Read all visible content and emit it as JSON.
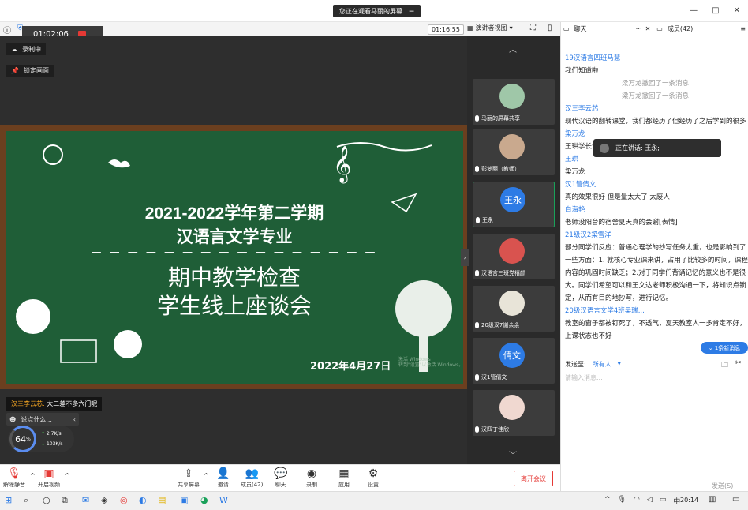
{
  "window": {
    "share_status": "您正在观看马丽的屏幕",
    "share_menu_icon": "menu-icon",
    "minimize": "—",
    "restore": "□",
    "close": "✕"
  },
  "toolbar": {
    "meeting_time": "01:16:55",
    "view_label": "演讲者视图",
    "recording_time": "01:02:06"
  },
  "stage": {
    "recording_label": "录制中",
    "lock_label": "锁定画面",
    "board": {
      "line1": "2021-2022学年第二学期",
      "line2": "汉语言文学专业",
      "dashes": "— — — — — — — — — — — — — — — —",
      "line3": "期中教学检查",
      "line4": "学生线上座谈会",
      "date": "2022年4月27日",
      "watermark1": "激活 Windows",
      "watermark2": "转到\"设置\"以激活 Windows。"
    },
    "toast": {
      "sender": "汉三李云芯:",
      "text": "大二差不多六门呢"
    },
    "quick_chat": "说点什么...",
    "network": {
      "percent": "64",
      "unit": "%",
      "up": "2.7K/s",
      "down": "103K/s"
    }
  },
  "participants": [
    {
      "name": "马丽的屏幕共享",
      "avatar_text": "",
      "color": "#9fc7a8"
    },
    {
      "name": "彭梦丽（教师）",
      "avatar_text": "",
      "color": "#c9a98e"
    },
    {
      "name": "王永",
      "avatar_text": "王永",
      "color": "#2d7be5"
    },
    {
      "name": "汉语言三班党禧颜",
      "avatar_text": "",
      "color": "#d9534f"
    },
    {
      "name": "20级汉7谢余余",
      "avatar_text": "",
      "color": "#e8e4d8"
    },
    {
      "name": "汉1管倩文",
      "avatar_text": "倩文",
      "color": "#2d7be5"
    },
    {
      "name": "汉四丁佳欣",
      "avatar_text": "",
      "color": "#f0d8d0"
    }
  ],
  "bottombar": {
    "mute": "解除静音",
    "video": "开启视频",
    "share": "共享屏幕",
    "invite": "邀请",
    "members": "成员(42)",
    "chat": "聊天",
    "record": "录制",
    "apps": "应用",
    "settings": "设置",
    "leave": "离开会议"
  },
  "chat": {
    "tab_chat": "聊天",
    "tab_members": "成员(42)",
    "messages": [
      {
        "sender": "19汉语言四班马慧",
        "text": "我们知道啦"
      },
      {
        "system": "梁万龙撤回了一条消息"
      },
      {
        "system": "梁万龙撤回了一条消息"
      },
      {
        "sender": "汉三李云芯",
        "text": "现代汉语的翻转课堂，我们都经历了但经历了之后学到的很多"
      },
      {
        "sender": "梁万龙",
        "text": "王珙学长说一说。"
      },
      {
        "sender": "王珙",
        "text": "梁万龙"
      },
      {
        "sender": "汉1管倩文",
        "text": "真的效果很好 但是量太大了 太废人"
      },
      {
        "sender": "白海艳",
        "text": "老师没阳台的宿舍夏天真的会谢[表情]"
      },
      {
        "sender": "21级汉2梁雪洋",
        "text": "部分同学们反应：普通心理学的抄写任务太重，也是影响到了一些方面：1. 就核心专业课来讲，占用了比较多的时间，课程内容的巩固时间缺乏；2.对于同学们背诵记忆的意义也不是很大。同学们希望可以和王文达老师积极沟通一下，将知识点锁定，从而有目的地抄写，进行记忆。"
      },
      {
        "sender": "20级汉语言文学4班吴瑞...",
        "text": "教室的窗子都被钉死了，不透气，夏天教室人一多肯定不好，上课状态也不好"
      }
    ],
    "speaking": "正在讲话: 王永;",
    "new_messages": "1条新消息",
    "send_to_label": "发送至:",
    "send_to_value": "所有人",
    "input_placeholder": "请输入消息...",
    "send_button": "发送(S)"
  },
  "taskbar": {
    "time": "20:14",
    "ime": "中"
  }
}
